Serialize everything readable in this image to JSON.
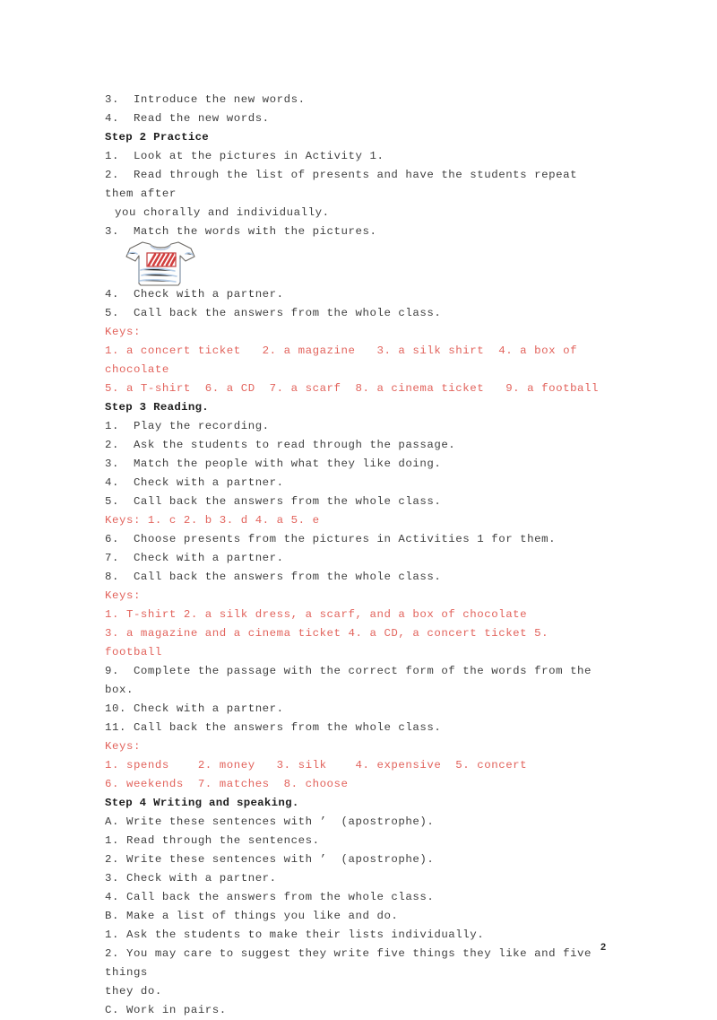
{
  "document": {
    "page_number": "2",
    "accent_red": "#e2635c",
    "text_color": "#3f3f3f"
  },
  "body_lines": [
    {
      "text": "3.  Introduce the new words.",
      "style": "normal"
    },
    {
      "text": "4.  Read the new words.",
      "style": "normal"
    },
    {
      "text": "Step 2 Practice",
      "style": "heading"
    },
    {
      "text": "1.  Look at the pictures in Activity 1.",
      "style": "normal"
    },
    {
      "text": "2.  Read through the list of presents and have the students repeat them after",
      "style": "normal"
    },
    {
      "text": "you chorally and individually.",
      "style": "indent"
    },
    {
      "text": "3.  Match the words with the pictures.",
      "style": "normal"
    },
    {
      "text": "__FIGURE_TSHIRT__",
      "style": "figure"
    },
    {
      "text": "4.  Check with a partner.",
      "style": "normal"
    },
    {
      "text": "5.  Call back the answers from the whole class.",
      "style": "normal"
    },
    {
      "text": "Keys:",
      "style": "red"
    },
    {
      "text": "1. a concert ticket   2. a magazine   3. a silk shirt  4. a box of chocolate",
      "style": "red"
    },
    {
      "text": "5. a T-shirt  6. a CD  7. a scarf  8. a cinema ticket   9. a football",
      "style": "red"
    },
    {
      "text": "Step 3 Reading.",
      "style": "heading"
    },
    {
      "text": "1.  Play the recording.",
      "style": "normal"
    },
    {
      "text": "2.  Ask the students to read through the passage.",
      "style": "normal"
    },
    {
      "text": "3.  Match the people with what they like doing.",
      "style": "normal"
    },
    {
      "text": "4.  Check with a partner.",
      "style": "normal"
    },
    {
      "text": "5.  Call back the answers from the whole class.",
      "style": "normal"
    },
    {
      "text": "Keys: 1. c 2. b 3. d 4. a 5. e",
      "style": "red"
    },
    {
      "text": "6.  Choose presents from the pictures in Activities 1 for them.",
      "style": "normal"
    },
    {
      "text": "7.  Check with a partner.",
      "style": "normal"
    },
    {
      "text": "8.  Call back the answers from the whole class.",
      "style": "normal"
    },
    {
      "text": "Keys:",
      "style": "red"
    },
    {
      "text": "1. T-shirt 2. a silk dress, a scarf, and a box of chocolate",
      "style": "red"
    },
    {
      "text": "3. a magazine and a cinema ticket 4. a CD, a concert ticket 5. football",
      "style": "red"
    },
    {
      "text": "9.  Complete the passage with the correct form of the words from the box.",
      "style": "normal"
    },
    {
      "text": "10. Check with a partner.",
      "style": "normal"
    },
    {
      "text": "11. Call back the answers from the whole class.",
      "style": "normal"
    },
    {
      "text": "Keys:",
      "style": "red"
    },
    {
      "text": "1. spends    2. money   3. silk    4. expensive  5. concert",
      "style": "red"
    },
    {
      "text": "6. weekends  7. matches  8. choose",
      "style": "red"
    },
    {
      "text": "Step 4 Writing and speaking.",
      "style": "heading"
    },
    {
      "text": "A. Write these sentences with ’  (apostrophe).",
      "style": "normal"
    },
    {
      "text": "1. Read through the sentences.",
      "style": "normal"
    },
    {
      "text": "2. Write these sentences with ’  (apostrophe).",
      "style": "normal"
    },
    {
      "text": "3. Check with a partner.",
      "style": "normal"
    },
    {
      "text": "4. Call back the answers from the whole class.",
      "style": "normal"
    },
    {
      "text": "B. Make a list of things you like and do.",
      "style": "normal"
    },
    {
      "text": "1. Ask the students to make their lists individually.",
      "style": "normal"
    },
    {
      "text": "2. You may care to suggest they write five things they like and five things",
      "style": "normal"
    },
    {
      "text": "they do.",
      "style": "normal"
    },
    {
      "text": "C. Work in pairs.",
      "style": "normal"
    }
  ],
  "figure": {
    "name": "t-shirt-illustration",
    "alt": "hand drawn white T-shirt with red and blue striped rectangle design"
  }
}
